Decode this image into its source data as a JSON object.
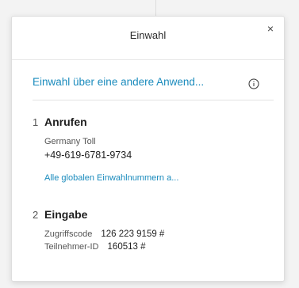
{
  "dialog": {
    "title": "Einwahl",
    "close_glyph": "×"
  },
  "alt_dial": {
    "link_text": "Einwahl über eine andere Anwend...",
    "info_icon": "info-icon"
  },
  "step1": {
    "number": "1",
    "title": "Anrufen",
    "region": "Germany Toll",
    "phone": "+49-619-6781-9734",
    "global_link": "Alle globalen Einwahlnummern a..."
  },
  "step2": {
    "number": "2",
    "title": "Eingabe",
    "access_code_label": "Zugriffscode",
    "access_code_value": "126 223 9159 #",
    "participant_label": "Teilnehmer-ID",
    "participant_value": "160513 #"
  },
  "colors": {
    "link": "#1a8bbd",
    "text": "#1f1f1f"
  }
}
